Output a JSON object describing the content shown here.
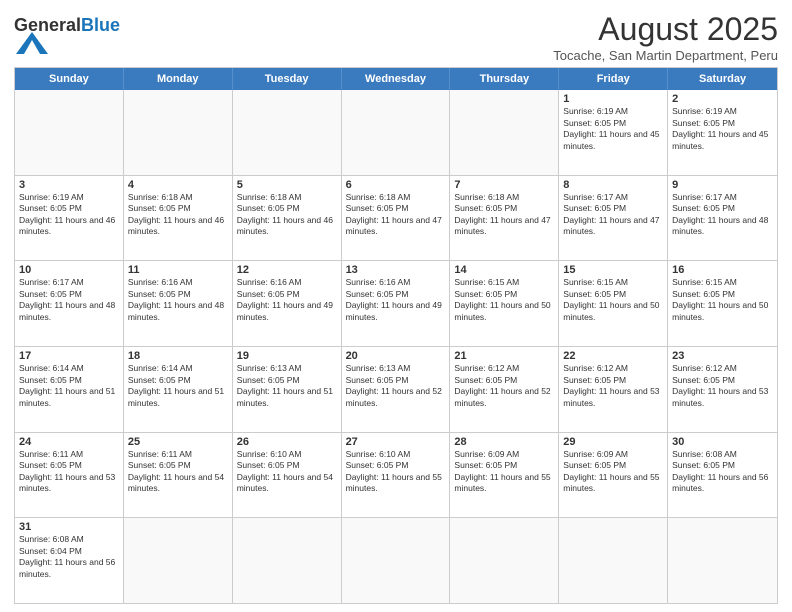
{
  "header": {
    "logo_general": "General",
    "logo_blue": "Blue",
    "month_title": "August 2025",
    "location": "Tocache, San Martin Department, Peru"
  },
  "weekdays": [
    "Sunday",
    "Monday",
    "Tuesday",
    "Wednesday",
    "Thursday",
    "Friday",
    "Saturday"
  ],
  "rows": [
    [
      {
        "day": "",
        "info": ""
      },
      {
        "day": "",
        "info": ""
      },
      {
        "day": "",
        "info": ""
      },
      {
        "day": "",
        "info": ""
      },
      {
        "day": "",
        "info": ""
      },
      {
        "day": "1",
        "info": "Sunrise: 6:19 AM\nSunset: 6:05 PM\nDaylight: 11 hours and 45 minutes."
      },
      {
        "day": "2",
        "info": "Sunrise: 6:19 AM\nSunset: 6:05 PM\nDaylight: 11 hours and 45 minutes."
      }
    ],
    [
      {
        "day": "3",
        "info": "Sunrise: 6:19 AM\nSunset: 6:05 PM\nDaylight: 11 hours and 46 minutes."
      },
      {
        "day": "4",
        "info": "Sunrise: 6:18 AM\nSunset: 6:05 PM\nDaylight: 11 hours and 46 minutes."
      },
      {
        "day": "5",
        "info": "Sunrise: 6:18 AM\nSunset: 6:05 PM\nDaylight: 11 hours and 46 minutes."
      },
      {
        "day": "6",
        "info": "Sunrise: 6:18 AM\nSunset: 6:05 PM\nDaylight: 11 hours and 47 minutes."
      },
      {
        "day": "7",
        "info": "Sunrise: 6:18 AM\nSunset: 6:05 PM\nDaylight: 11 hours and 47 minutes."
      },
      {
        "day": "8",
        "info": "Sunrise: 6:17 AM\nSunset: 6:05 PM\nDaylight: 11 hours and 47 minutes."
      },
      {
        "day": "9",
        "info": "Sunrise: 6:17 AM\nSunset: 6:05 PM\nDaylight: 11 hours and 48 minutes."
      }
    ],
    [
      {
        "day": "10",
        "info": "Sunrise: 6:17 AM\nSunset: 6:05 PM\nDaylight: 11 hours and 48 minutes."
      },
      {
        "day": "11",
        "info": "Sunrise: 6:16 AM\nSunset: 6:05 PM\nDaylight: 11 hours and 48 minutes."
      },
      {
        "day": "12",
        "info": "Sunrise: 6:16 AM\nSunset: 6:05 PM\nDaylight: 11 hours and 49 minutes."
      },
      {
        "day": "13",
        "info": "Sunrise: 6:16 AM\nSunset: 6:05 PM\nDaylight: 11 hours and 49 minutes."
      },
      {
        "day": "14",
        "info": "Sunrise: 6:15 AM\nSunset: 6:05 PM\nDaylight: 11 hours and 50 minutes."
      },
      {
        "day": "15",
        "info": "Sunrise: 6:15 AM\nSunset: 6:05 PM\nDaylight: 11 hours and 50 minutes."
      },
      {
        "day": "16",
        "info": "Sunrise: 6:15 AM\nSunset: 6:05 PM\nDaylight: 11 hours and 50 minutes."
      }
    ],
    [
      {
        "day": "17",
        "info": "Sunrise: 6:14 AM\nSunset: 6:05 PM\nDaylight: 11 hours and 51 minutes."
      },
      {
        "day": "18",
        "info": "Sunrise: 6:14 AM\nSunset: 6:05 PM\nDaylight: 11 hours and 51 minutes."
      },
      {
        "day": "19",
        "info": "Sunrise: 6:13 AM\nSunset: 6:05 PM\nDaylight: 11 hours and 51 minutes."
      },
      {
        "day": "20",
        "info": "Sunrise: 6:13 AM\nSunset: 6:05 PM\nDaylight: 11 hours and 52 minutes."
      },
      {
        "day": "21",
        "info": "Sunrise: 6:12 AM\nSunset: 6:05 PM\nDaylight: 11 hours and 52 minutes."
      },
      {
        "day": "22",
        "info": "Sunrise: 6:12 AM\nSunset: 6:05 PM\nDaylight: 11 hours and 53 minutes."
      },
      {
        "day": "23",
        "info": "Sunrise: 6:12 AM\nSunset: 6:05 PM\nDaylight: 11 hours and 53 minutes."
      }
    ],
    [
      {
        "day": "24",
        "info": "Sunrise: 6:11 AM\nSunset: 6:05 PM\nDaylight: 11 hours and 53 minutes."
      },
      {
        "day": "25",
        "info": "Sunrise: 6:11 AM\nSunset: 6:05 PM\nDaylight: 11 hours and 54 minutes."
      },
      {
        "day": "26",
        "info": "Sunrise: 6:10 AM\nSunset: 6:05 PM\nDaylight: 11 hours and 54 minutes."
      },
      {
        "day": "27",
        "info": "Sunrise: 6:10 AM\nSunset: 6:05 PM\nDaylight: 11 hours and 55 minutes."
      },
      {
        "day": "28",
        "info": "Sunrise: 6:09 AM\nSunset: 6:05 PM\nDaylight: 11 hours and 55 minutes."
      },
      {
        "day": "29",
        "info": "Sunrise: 6:09 AM\nSunset: 6:05 PM\nDaylight: 11 hours and 55 minutes."
      },
      {
        "day": "30",
        "info": "Sunrise: 6:08 AM\nSunset: 6:05 PM\nDaylight: 11 hours and 56 minutes."
      }
    ],
    [
      {
        "day": "31",
        "info": "Sunrise: 6:08 AM\nSunset: 6:04 PM\nDaylight: 11 hours and 56 minutes."
      },
      {
        "day": "",
        "info": ""
      },
      {
        "day": "",
        "info": ""
      },
      {
        "day": "",
        "info": ""
      },
      {
        "day": "",
        "info": ""
      },
      {
        "day": "",
        "info": ""
      },
      {
        "day": "",
        "info": ""
      }
    ]
  ]
}
